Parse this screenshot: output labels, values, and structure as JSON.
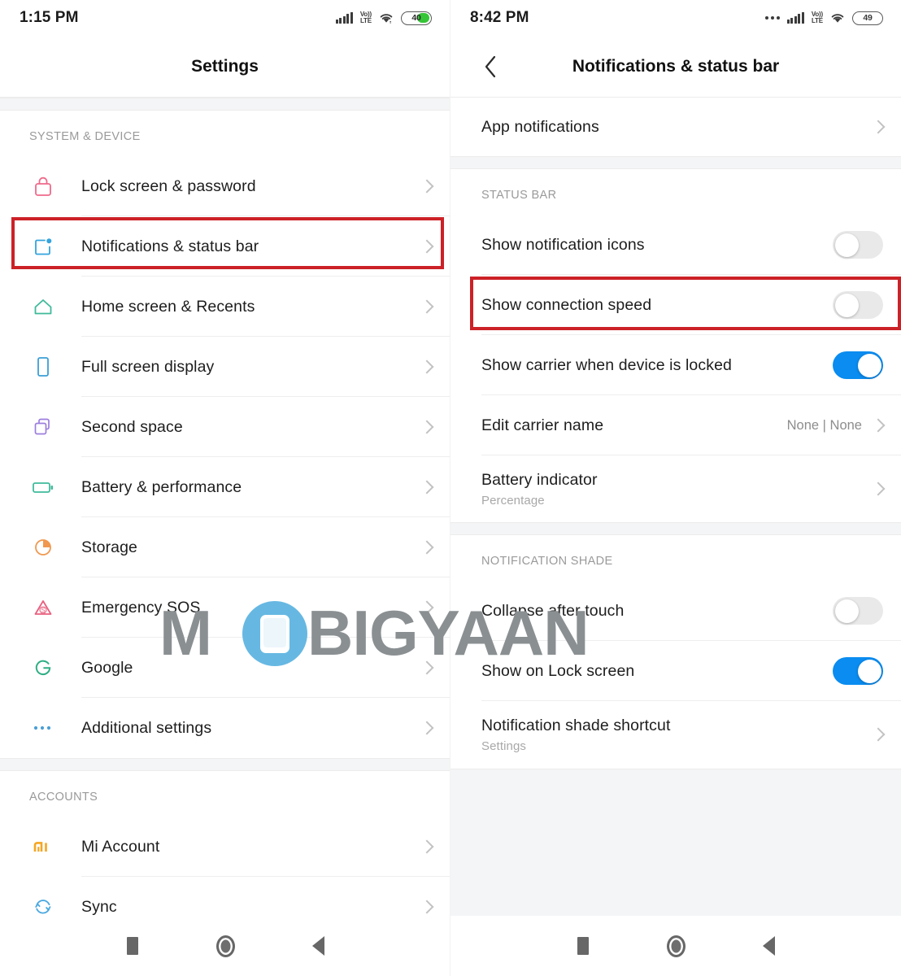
{
  "left": {
    "status": {
      "time": "1:15 PM",
      "signal_icon": "signal-bars-icon",
      "network_label_top": "Vo))",
      "network_label_bottom": "LTE",
      "wifi_icon": "wifi-icon",
      "battery_percent": "40",
      "battery_fill_color": "#36c537"
    },
    "appbar": {
      "title": "Settings"
    },
    "sections": [
      {
        "header": "SYSTEM & DEVICE",
        "items": [
          {
            "label": "Lock screen & password",
            "icon": "lock-icon",
            "color": "#ef6a8b"
          },
          {
            "label": "Notifications & status bar",
            "icon": "notification-badge-icon",
            "color": "#33a4dd"
          },
          {
            "label": "Home screen & Recents",
            "icon": "home-icon",
            "color": "#3fba9a"
          },
          {
            "label": "Full screen display",
            "icon": "phone-icon",
            "color": "#3b9fd6"
          },
          {
            "label": "Second space",
            "icon": "second-space-icon",
            "color": "#9c7ede"
          },
          {
            "label": "Battery & performance",
            "icon": "battery-icon",
            "color": "#3fbb9c"
          },
          {
            "label": "Storage",
            "icon": "storage-pie-icon",
            "color": "#f0984f"
          },
          {
            "label": "Emergency SOS",
            "icon": "sos-warning-icon",
            "color": "#e8607f"
          },
          {
            "label": "Google",
            "icon": "google-g-icon",
            "color": "#2fae85"
          },
          {
            "label": "Additional settings",
            "icon": "ellipsis-icon",
            "color": "#4a9fd4"
          }
        ]
      },
      {
        "header": "ACCOUNTS",
        "items": [
          {
            "label": "Mi Account",
            "icon": "mi-logo-icon",
            "color": "#f5a623"
          },
          {
            "label": "Sync",
            "icon": "sync-icon",
            "color": "#4aa8e0"
          }
        ]
      }
    ],
    "highlight": {
      "target_label": "Notifications & status bar",
      "color": "#cc2127"
    }
  },
  "right": {
    "status": {
      "time": "8:42 PM",
      "overflow_icon": "more-dots-icon",
      "signal_icon": "signal-bars-icon",
      "network_label_top": "Vo))",
      "network_label_bottom": "LTE",
      "wifi_icon": "wifi-icon",
      "battery_percent": "49"
    },
    "appbar": {
      "title": "Notifications & status bar",
      "back_icon": "chevron-left-icon"
    },
    "top_items": [
      {
        "label": "App notifications",
        "type": "link"
      }
    ],
    "sections": [
      {
        "header": "STATUS BAR",
        "items": [
          {
            "label": "Show notification icons",
            "type": "toggle",
            "state": "off"
          },
          {
            "label": "Show connection speed",
            "type": "toggle",
            "state": "off"
          },
          {
            "label": "Show carrier when device is locked",
            "type": "toggle",
            "state": "on"
          },
          {
            "label": "Edit carrier name",
            "type": "link",
            "value": "None | None"
          },
          {
            "label": "Battery indicator",
            "type": "link",
            "sub": "Percentage"
          }
        ]
      },
      {
        "header": "NOTIFICATION SHADE",
        "items": [
          {
            "label": "Collapse after touch",
            "type": "toggle",
            "state": "off"
          },
          {
            "label": "Show on Lock screen",
            "type": "toggle",
            "state": "on"
          },
          {
            "label": "Notification shade shortcut",
            "type": "link",
            "sub": "Settings"
          }
        ]
      }
    ],
    "highlight": {
      "target_label": "Show connection speed",
      "color": "#cc2127"
    }
  },
  "watermark": {
    "text": "MOBIGYAAN",
    "text_color": "#8a8f92",
    "accent_color": "#66b8e2"
  },
  "navbar": {
    "buttons": [
      {
        "name": "recents-button",
        "icon": "square-icon"
      },
      {
        "name": "home-button",
        "icon": "circle-icon"
      },
      {
        "name": "back-button",
        "icon": "triangle-back-icon"
      }
    ]
  },
  "theme": {
    "toggle_on": "#0a8cf0",
    "toggle_off": "#e9e9e9",
    "divider": "#eeeeee",
    "group_bg": "#f4f5f6",
    "header_text": "#9a9a9a",
    "label_text": "#1d1d1d"
  }
}
